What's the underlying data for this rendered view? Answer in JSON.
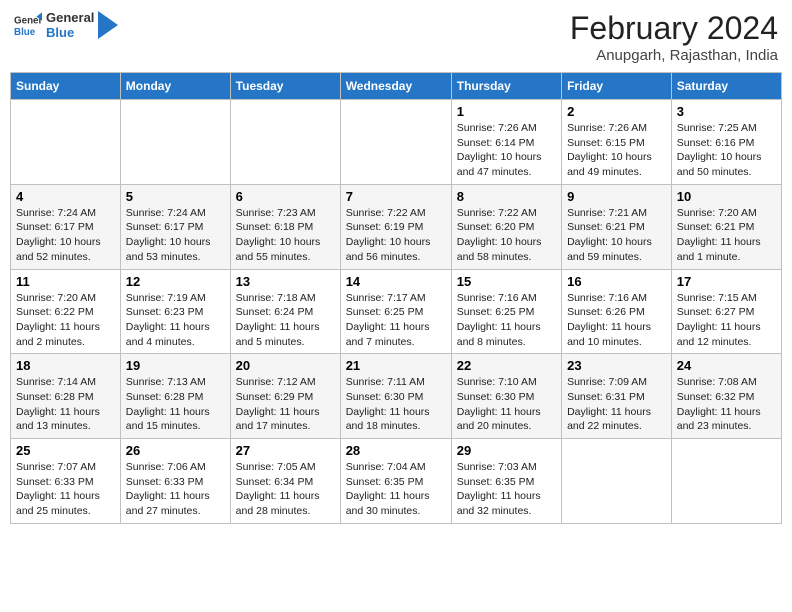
{
  "logo": {
    "general": "General",
    "blue": "Blue"
  },
  "title": "February 2024",
  "location": "Anupgarh, Rajasthan, India",
  "weekdays": [
    "Sunday",
    "Monday",
    "Tuesday",
    "Wednesday",
    "Thursday",
    "Friday",
    "Saturday"
  ],
  "weeks": [
    [
      {
        "day": "",
        "info": ""
      },
      {
        "day": "",
        "info": ""
      },
      {
        "day": "",
        "info": ""
      },
      {
        "day": "",
        "info": ""
      },
      {
        "day": "1",
        "info": "Sunrise: 7:26 AM\nSunset: 6:14 PM\nDaylight: 10 hours\nand 47 minutes."
      },
      {
        "day": "2",
        "info": "Sunrise: 7:26 AM\nSunset: 6:15 PM\nDaylight: 10 hours\nand 49 minutes."
      },
      {
        "day": "3",
        "info": "Sunrise: 7:25 AM\nSunset: 6:16 PM\nDaylight: 10 hours\nand 50 minutes."
      }
    ],
    [
      {
        "day": "4",
        "info": "Sunrise: 7:24 AM\nSunset: 6:17 PM\nDaylight: 10 hours\nand 52 minutes."
      },
      {
        "day": "5",
        "info": "Sunrise: 7:24 AM\nSunset: 6:17 PM\nDaylight: 10 hours\nand 53 minutes."
      },
      {
        "day": "6",
        "info": "Sunrise: 7:23 AM\nSunset: 6:18 PM\nDaylight: 10 hours\nand 55 minutes."
      },
      {
        "day": "7",
        "info": "Sunrise: 7:22 AM\nSunset: 6:19 PM\nDaylight: 10 hours\nand 56 minutes."
      },
      {
        "day": "8",
        "info": "Sunrise: 7:22 AM\nSunset: 6:20 PM\nDaylight: 10 hours\nand 58 minutes."
      },
      {
        "day": "9",
        "info": "Sunrise: 7:21 AM\nSunset: 6:21 PM\nDaylight: 10 hours\nand 59 minutes."
      },
      {
        "day": "10",
        "info": "Sunrise: 7:20 AM\nSunset: 6:21 PM\nDaylight: 11 hours\nand 1 minute."
      }
    ],
    [
      {
        "day": "11",
        "info": "Sunrise: 7:20 AM\nSunset: 6:22 PM\nDaylight: 11 hours\nand 2 minutes."
      },
      {
        "day": "12",
        "info": "Sunrise: 7:19 AM\nSunset: 6:23 PM\nDaylight: 11 hours\nand 4 minutes."
      },
      {
        "day": "13",
        "info": "Sunrise: 7:18 AM\nSunset: 6:24 PM\nDaylight: 11 hours\nand 5 minutes."
      },
      {
        "day": "14",
        "info": "Sunrise: 7:17 AM\nSunset: 6:25 PM\nDaylight: 11 hours\nand 7 minutes."
      },
      {
        "day": "15",
        "info": "Sunrise: 7:16 AM\nSunset: 6:25 PM\nDaylight: 11 hours\nand 8 minutes."
      },
      {
        "day": "16",
        "info": "Sunrise: 7:16 AM\nSunset: 6:26 PM\nDaylight: 11 hours\nand 10 minutes."
      },
      {
        "day": "17",
        "info": "Sunrise: 7:15 AM\nSunset: 6:27 PM\nDaylight: 11 hours\nand 12 minutes."
      }
    ],
    [
      {
        "day": "18",
        "info": "Sunrise: 7:14 AM\nSunset: 6:28 PM\nDaylight: 11 hours\nand 13 minutes."
      },
      {
        "day": "19",
        "info": "Sunrise: 7:13 AM\nSunset: 6:28 PM\nDaylight: 11 hours\nand 15 minutes."
      },
      {
        "day": "20",
        "info": "Sunrise: 7:12 AM\nSunset: 6:29 PM\nDaylight: 11 hours\nand 17 minutes."
      },
      {
        "day": "21",
        "info": "Sunrise: 7:11 AM\nSunset: 6:30 PM\nDaylight: 11 hours\nand 18 minutes."
      },
      {
        "day": "22",
        "info": "Sunrise: 7:10 AM\nSunset: 6:30 PM\nDaylight: 11 hours\nand 20 minutes."
      },
      {
        "day": "23",
        "info": "Sunrise: 7:09 AM\nSunset: 6:31 PM\nDaylight: 11 hours\nand 22 minutes."
      },
      {
        "day": "24",
        "info": "Sunrise: 7:08 AM\nSunset: 6:32 PM\nDaylight: 11 hours\nand 23 minutes."
      }
    ],
    [
      {
        "day": "25",
        "info": "Sunrise: 7:07 AM\nSunset: 6:33 PM\nDaylight: 11 hours\nand 25 minutes."
      },
      {
        "day": "26",
        "info": "Sunrise: 7:06 AM\nSunset: 6:33 PM\nDaylight: 11 hours\nand 27 minutes."
      },
      {
        "day": "27",
        "info": "Sunrise: 7:05 AM\nSunset: 6:34 PM\nDaylight: 11 hours\nand 28 minutes."
      },
      {
        "day": "28",
        "info": "Sunrise: 7:04 AM\nSunset: 6:35 PM\nDaylight: 11 hours\nand 30 minutes."
      },
      {
        "day": "29",
        "info": "Sunrise: 7:03 AM\nSunset: 6:35 PM\nDaylight: 11 hours\nand 32 minutes."
      },
      {
        "day": "",
        "info": ""
      },
      {
        "day": "",
        "info": ""
      }
    ]
  ]
}
